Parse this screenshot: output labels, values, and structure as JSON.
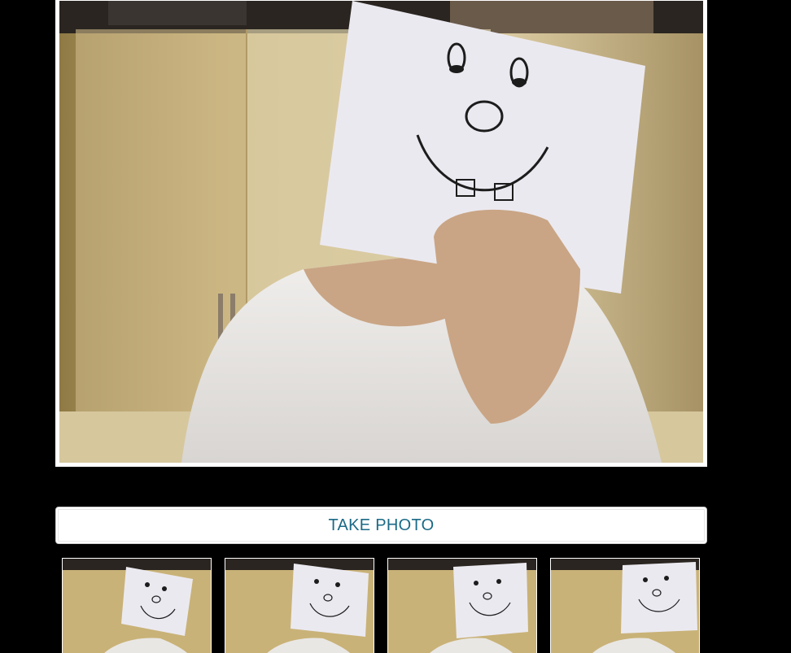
{
  "camera": {
    "preview_label": "camera-preview",
    "scene_colors": {
      "wall": "#c9b277",
      "cabinet": "#ddd0a8",
      "shirt": "#e9e7e4",
      "skin": "#c9a585",
      "paper": "#ebe9f0",
      "ink": "#1c1c1c"
    }
  },
  "actions": {
    "take_photo_label": "TAKE PHOTO"
  },
  "thumbnails": [
    {
      "id": "photo-1"
    },
    {
      "id": "photo-2"
    },
    {
      "id": "photo-3"
    },
    {
      "id": "photo-4"
    }
  ]
}
